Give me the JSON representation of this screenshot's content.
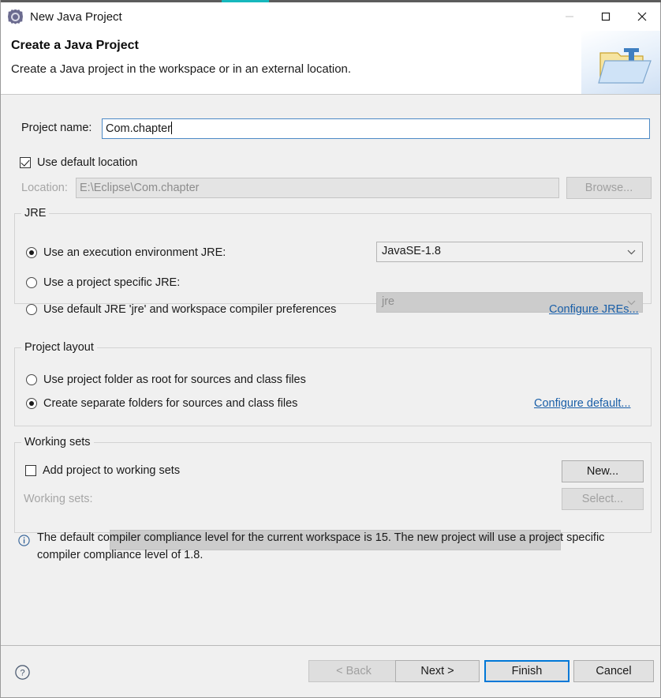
{
  "window": {
    "title": "New Java Project",
    "icon": "eclipse-gear-icon",
    "accent_color": "#16b8bd",
    "controls": {
      "minimize": "minimize-icon",
      "maximize": "maximize-icon",
      "close": "close-icon"
    }
  },
  "header": {
    "title": "Create a Java Project",
    "subtitle": "Create a Java project in the workspace or in an external location.",
    "graphic": "java-project-folder-icon"
  },
  "form": {
    "project_name": {
      "label": "Project name:",
      "value": "Com.chapter",
      "placeholder": ""
    },
    "use_default_location": {
      "label": "Use default location",
      "checked": true
    },
    "location": {
      "label": "Location:",
      "value": "E:\\Eclipse\\Com.chapter",
      "enabled": false
    },
    "browse_button": {
      "label": "Browse...",
      "enabled": false
    }
  },
  "jre_group": {
    "title": "JRE",
    "options": [
      {
        "label": "Use an execution environment JRE:",
        "selected": true
      },
      {
        "label": "Use a project specific JRE:",
        "selected": false
      },
      {
        "label": "Use default JRE 'jre' and workspace compiler preferences",
        "selected": false
      }
    ],
    "execution_env_combo": {
      "value": "JavaSE-1.8",
      "enabled": true
    },
    "specific_jre_combo": {
      "value": "jre",
      "enabled": false
    },
    "configure_link": "Configure JREs..."
  },
  "layout_group": {
    "title": "Project layout",
    "options": [
      {
        "label": "Use project folder as root for sources and class files",
        "selected": false
      },
      {
        "label": "Create separate folders for sources and class files",
        "selected": true
      }
    ],
    "configure_link": "Configure default..."
  },
  "working_sets_group": {
    "title": "Working sets",
    "add_checkbox": {
      "label": "Add project to working sets",
      "checked": false
    },
    "working_sets_label": "Working sets:",
    "working_sets_combo": {
      "value": "",
      "enabled": false
    },
    "new_button": {
      "label": "New...",
      "enabled": true
    },
    "select_button": {
      "label": "Select...",
      "enabled": false
    }
  },
  "info": {
    "icon": "info-icon",
    "message": "The default compiler compliance level for the current workspace is 15. The new project will use a project specific compiler compliance level of 1.8."
  },
  "footer": {
    "help_icon": "help-icon",
    "buttons": [
      {
        "label": "< Back",
        "enabled": false,
        "default": false
      },
      {
        "label": "Next >",
        "enabled": true,
        "default": false
      },
      {
        "label": "Finish",
        "enabled": true,
        "default": true
      },
      {
        "label": "Cancel",
        "enabled": true,
        "default": false
      }
    ]
  }
}
